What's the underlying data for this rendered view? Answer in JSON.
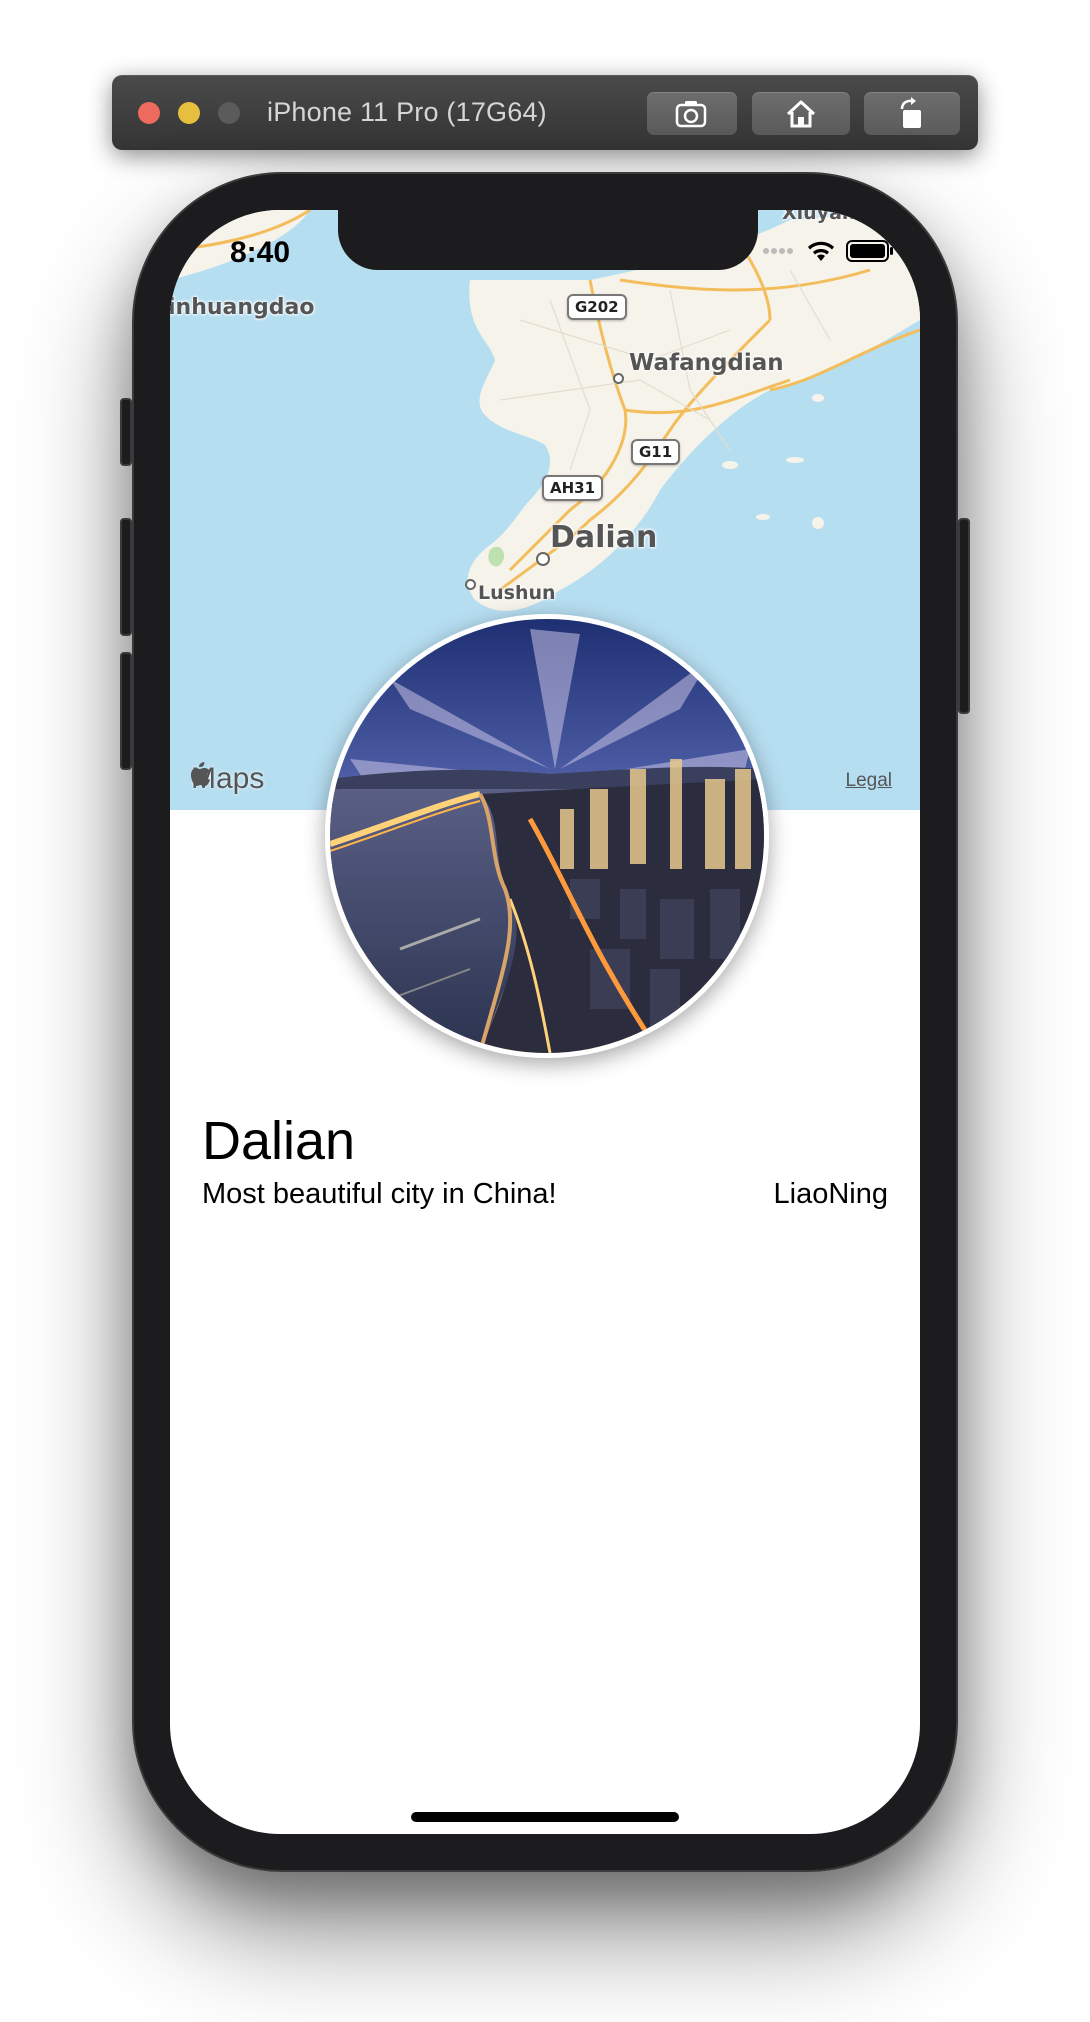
{
  "simulator": {
    "title": "iPhone 11 Pro (17G64)",
    "buttons": [
      {
        "name": "screenshot",
        "icon": "camera-icon"
      },
      {
        "name": "home",
        "icon": "home-icon"
      },
      {
        "name": "rotate",
        "icon": "rotate-icon"
      }
    ]
  },
  "status_bar": {
    "time": "8:40",
    "icons": [
      "wifi-icon",
      "battery-icon"
    ]
  },
  "map": {
    "labels": {
      "qinhuangdao": "inhuangdao",
      "xiuyan": "Xiuyan",
      "wafangdian": "Wafangdian",
      "dalian": "Dalian",
      "lushun": "Lushun"
    },
    "road_shields": {
      "g202": "G202",
      "g11": "G11",
      "ah31": "AH31"
    },
    "attribution": "Maps",
    "legal": "Legal",
    "colors": {
      "water": "#b6def1",
      "land": "#f6f3ea",
      "road": "#f3bd5c"
    }
  },
  "detail": {
    "title": "Dalian",
    "subtitle": "Most beautiful city in China!",
    "region": "LiaoNing"
  }
}
